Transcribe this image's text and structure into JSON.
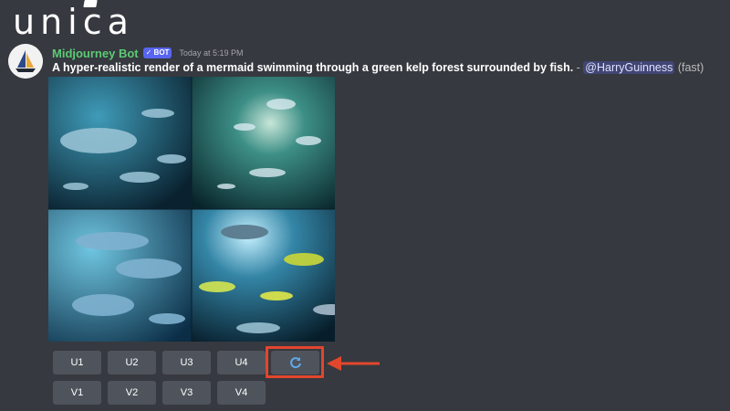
{
  "brand": {
    "logo_text": "unica"
  },
  "message": {
    "username": "Midjourney Bot",
    "badge": "✓ BOT",
    "timestamp": "Today at 5:19 PM",
    "prompt": "A hyper-realistic render of a mermaid swimming through a green kelp forest surrounded by fish.",
    "separator": " - ",
    "mention": "@HarryGuinness",
    "mode": "(fast)"
  },
  "image": {
    "description_icon": "image-grid",
    "quadrants": 4
  },
  "buttons": {
    "upscale": [
      "U1",
      "U2",
      "U3",
      "U4"
    ],
    "variation": [
      "V1",
      "V2",
      "V3",
      "V4"
    ],
    "reroll_icon": "refresh-icon"
  },
  "colors": {
    "background": "#36393f",
    "button": "#4f545c",
    "username": "#5ccb74",
    "badge": "#5865f2",
    "highlight": "#e2462d"
  }
}
